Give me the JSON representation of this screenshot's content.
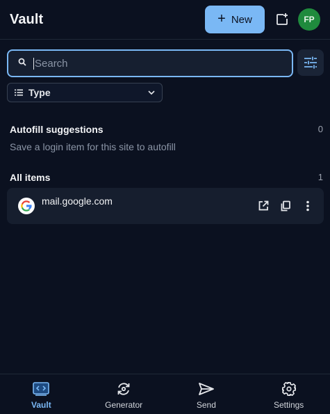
{
  "header": {
    "title": "Vault",
    "new_label": "New",
    "avatar_initials": "FP"
  },
  "search": {
    "placeholder": "Search",
    "value": ""
  },
  "filter": {
    "type_label": "Type"
  },
  "autofill": {
    "title": "Autofill suggestions",
    "count": "0",
    "hint": "Save a login item for this site to autofill"
  },
  "all_items": {
    "title": "All items",
    "count": "1",
    "items": [
      {
        "name": "mail.google.com",
        "icon": "google-icon"
      }
    ]
  },
  "nav": [
    {
      "label": "Vault",
      "icon": "vault-icon",
      "active": true
    },
    {
      "label": "Generator",
      "icon": "generator-icon",
      "active": false
    },
    {
      "label": "Send",
      "icon": "send-icon",
      "active": false
    },
    {
      "label": "Settings",
      "icon": "settings-icon",
      "active": false
    }
  ],
  "colors": {
    "accent": "#7ab8f5",
    "background": "#0b1120",
    "avatar": "#1f8a3d"
  }
}
